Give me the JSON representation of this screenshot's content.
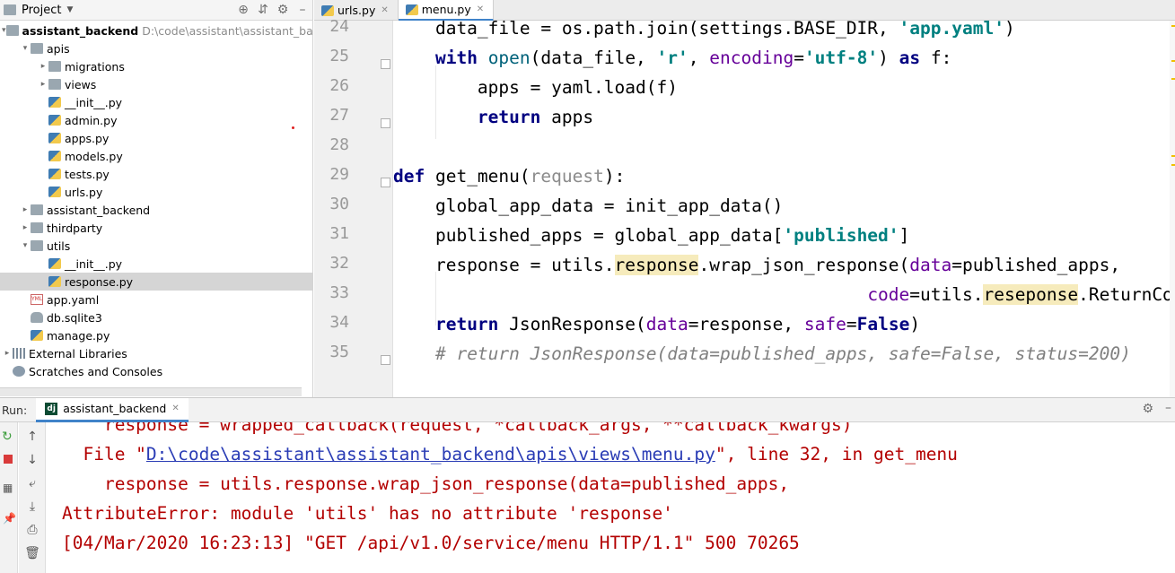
{
  "project": {
    "title": "Project",
    "tree": [
      {
        "label": "assistant_backend",
        "path": "D:\\code\\assistant\\assistant_backend",
        "icon": "folder-icon",
        "arrow": "▾",
        "indent": 0,
        "bold": true
      },
      {
        "label": "apis",
        "icon": "folder-icon",
        "arrow": "▾",
        "indent": 1
      },
      {
        "label": "migrations",
        "icon": "folder-icon",
        "arrow": "▸",
        "indent": 2
      },
      {
        "label": "views",
        "icon": "folder-icon",
        "arrow": "▸",
        "indent": 2
      },
      {
        "label": "__init__.py",
        "icon": "python-file-icon",
        "arrow": "",
        "indent": 2
      },
      {
        "label": "admin.py",
        "icon": "python-file-icon",
        "arrow": "",
        "indent": 2
      },
      {
        "label": "apps.py",
        "icon": "python-file-icon",
        "arrow": "",
        "indent": 2
      },
      {
        "label": "models.py",
        "icon": "python-file-icon",
        "arrow": "",
        "indent": 2
      },
      {
        "label": "tests.py",
        "icon": "python-file-icon",
        "arrow": "",
        "indent": 2
      },
      {
        "label": "urls.py",
        "icon": "python-file-icon",
        "arrow": "",
        "indent": 2
      },
      {
        "label": "assistant_backend",
        "icon": "folder-icon",
        "arrow": "▸",
        "indent": 1
      },
      {
        "label": "thirdparty",
        "icon": "folder-icon",
        "arrow": "▸",
        "indent": 1
      },
      {
        "label": "utils",
        "icon": "folder-icon",
        "arrow": "▾",
        "indent": 1
      },
      {
        "label": "__init__.py",
        "icon": "python-file-icon",
        "arrow": "",
        "indent": 2
      },
      {
        "label": "response.py",
        "icon": "python-file-icon",
        "arrow": "",
        "indent": 2,
        "selected": true
      },
      {
        "label": "app.yaml",
        "icon": "yaml-file-icon",
        "arrow": "",
        "indent": 1
      },
      {
        "label": "db.sqlite3",
        "icon": "database-icon",
        "arrow": "",
        "indent": 1
      },
      {
        "label": "manage.py",
        "icon": "python-file-icon",
        "arrow": "",
        "indent": 1
      },
      {
        "label": "External Libraries",
        "icon": "library-icon",
        "arrow": "▸",
        "indent": 0
      },
      {
        "label": "Scratches and Consoles",
        "icon": "scratches-icon",
        "arrow": "",
        "indent": 0
      }
    ]
  },
  "editor": {
    "tabs": [
      {
        "label": "urls.py",
        "active": false
      },
      {
        "label": "menu.py",
        "active": true
      }
    ],
    "lines": [
      {
        "num": "24",
        "html": "    data_file = os.path.join(settings.BASE_DIR, <span class=\"st\">'app.yaml'</span>)"
      },
      {
        "num": "25",
        "html": "    <span class=\"kw\">with</span> <span class=\"fn\">open</span>(data_file, <span class=\"st\">'r'</span>, <span class=\"pm\">encoding</span>=<span class=\"st\">'utf-8'</span>) <span class=\"kw\">as</span> f:"
      },
      {
        "num": "26",
        "html": "        apps = yaml.load(f)"
      },
      {
        "num": "27",
        "html": "        <span class=\"kw\">return</span> apps"
      },
      {
        "num": "28",
        "html": ""
      },
      {
        "num": "29",
        "html": "<span class=\"kw\">def</span> get_menu(<span class=\"un\">request</span>):"
      },
      {
        "num": "30",
        "html": "    global_app_data = init_app_data()"
      },
      {
        "num": "31",
        "html": "    published_apps = global_app_data[<span class=\"st\">'published'</span>]"
      },
      {
        "num": "32",
        "html": "    response = utils.<span class=\"hl\">response</span>.wrap_json_response(<span class=\"pm\">data</span>=published_apps,"
      },
      {
        "num": "33",
        "html": "                                             <span class=\"pm\">code</span>=utils.<span class=\"hl\">reseponse</span>.ReturnCode.SUCCESS)"
      },
      {
        "num": "34",
        "html": "    <span class=\"kw\">return</span> JsonResponse(<span class=\"pm\">data</span>=response, <span class=\"pm\">safe</span>=<span class=\"kw\">False</span>)"
      },
      {
        "num": "35",
        "html": "    <span class=\"cm\"># return JsonResponse(data=published_apps, safe=False, status=200)</span>"
      }
    ]
  },
  "run": {
    "label": "Run:",
    "tab": "assistant_backend",
    "console": [
      {
        "html": "    response = wrapped_callback(request, *callback_args, **callback_kwargs)"
      },
      {
        "html": "  File \"<span class=\"link\">D:\\code\\assistant\\assistant_backend\\apis\\views\\menu.py</span>\", line 32, in get_menu"
      },
      {
        "html": "    response = utils.response.wrap_json_response(data=published_apps,"
      },
      {
        "html": "AttributeError: module 'utils' has no attribute 'response'"
      },
      {
        "html": "[04/Mar/2020 16:23:13] \"GET /api/v1.0/service/menu HTTP/1.1\" 500 70265"
      }
    ]
  }
}
